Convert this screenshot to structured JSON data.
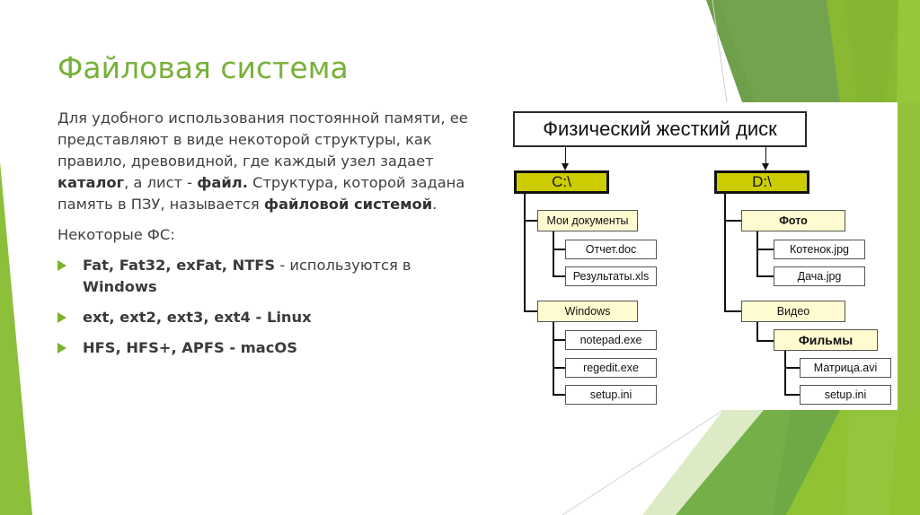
{
  "slide": {
    "title": "Файловая система",
    "paragraph": {
      "t1": "Для удобного использования постоянной памяти, ее представляют в виде некоторой структуры, как правило, древовидной, где каждый узел задает ",
      "b1": "каталог",
      "t2": ", а лист - ",
      "b2": "файл.",
      "t3": " Структура, которой задана память в ПЗУ, называется ",
      "b3": "файловой системой",
      "t4": "."
    },
    "subheading": "Некоторые ФС:",
    "bullets": [
      {
        "bold": "Fat, Fat32, exFat, NTFS",
        "rest": " - используются в ",
        "bold2": "Windows"
      },
      {
        "bold": "ext, ext2, ext3, ext4 - Linux",
        "rest": "",
        "bold2": ""
      },
      {
        "bold": "HFS, HFS+, APFS - macOS",
        "rest": "",
        "bold2": ""
      }
    ],
    "bullet_icon": "triangle-right-icon",
    "accent_color": "#78b13a"
  },
  "diagram": {
    "root": "Физический жесткий диск",
    "drives": [
      {
        "label": "C:\\",
        "folders": [
          {
            "label": "Мои документы",
            "files": [
              "Отчет.doc",
              "Результаты.xls"
            ]
          },
          {
            "label": "Windows",
            "files": [
              "notepad.exe",
              "regedit.exe",
              "setup.ini"
            ]
          }
        ]
      },
      {
        "label": "D:\\",
        "folders": [
          {
            "label": "Фото",
            "files": [
              "Котенок.jpg",
              "Дача.jpg"
            ]
          },
          {
            "label": "Видео",
            "subfolder": {
              "label": "Фильмы",
              "files": [
                "Матрица.avi",
                "setup.ini"
              ]
            }
          }
        ]
      }
    ],
    "drive_color": "#cccc00",
    "folder_color": "#fffbd0"
  }
}
